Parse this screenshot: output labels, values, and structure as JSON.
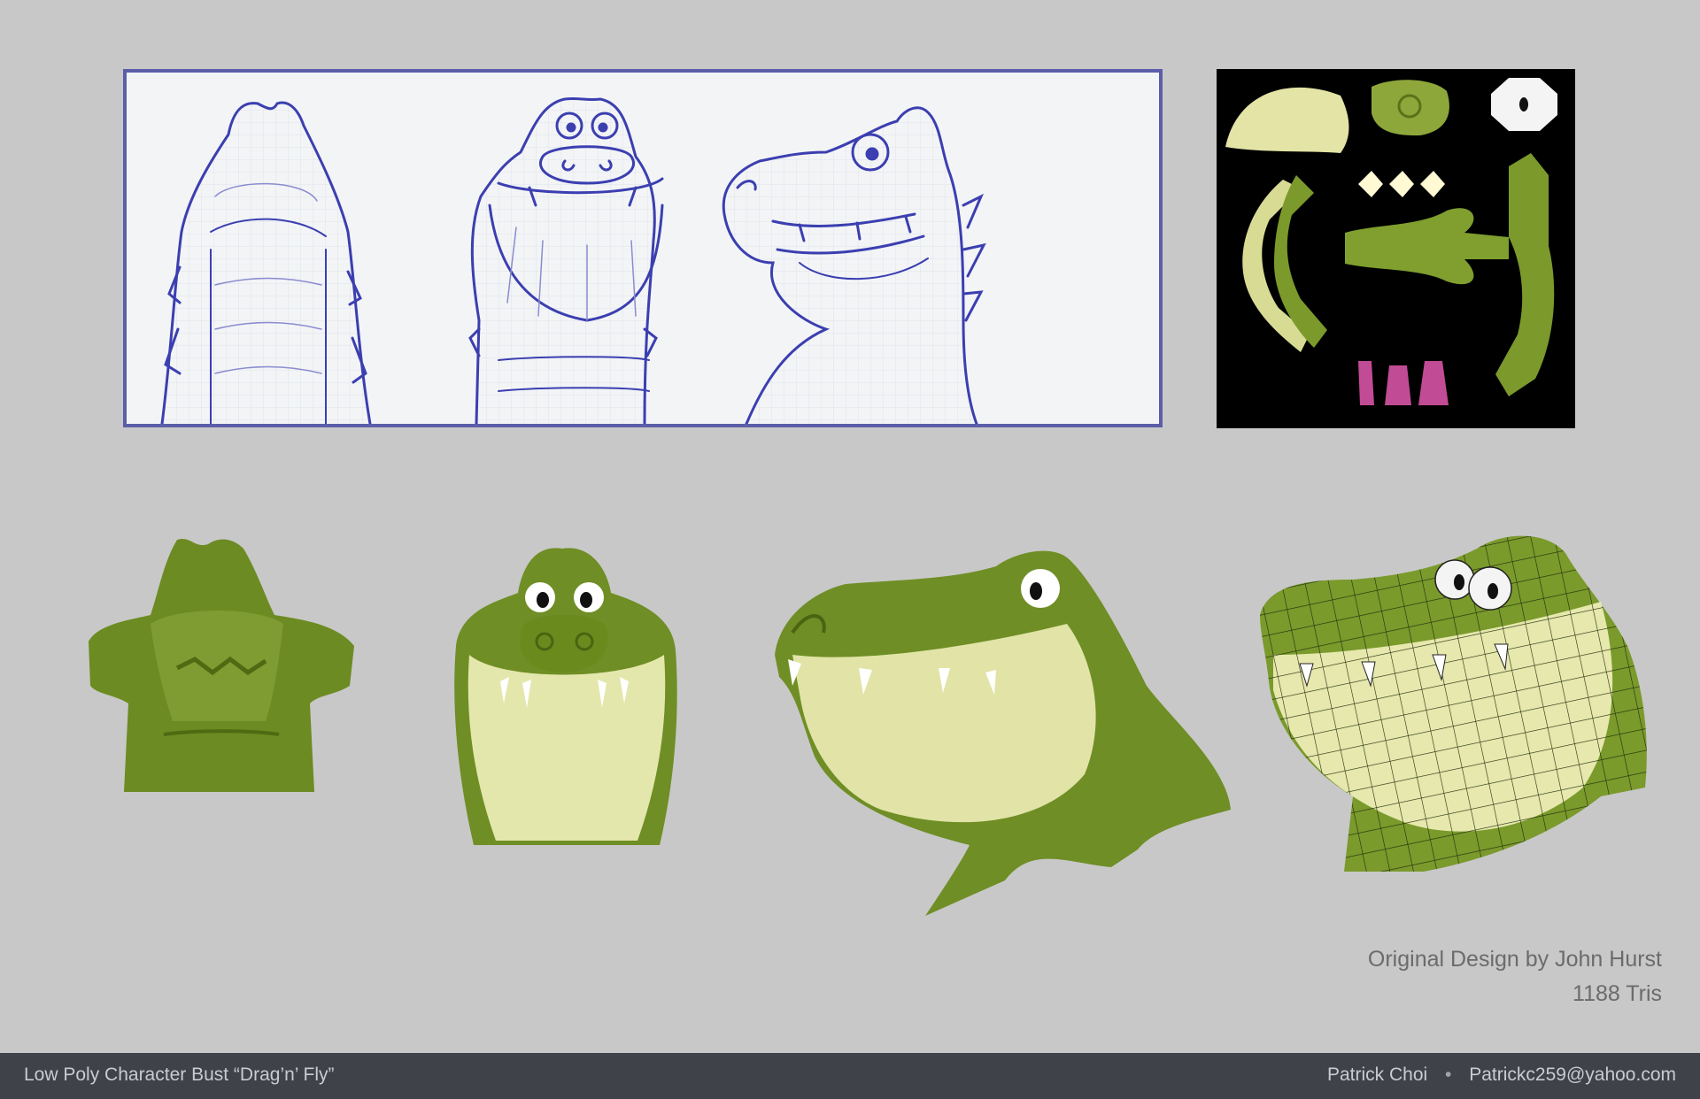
{
  "credits": {
    "design": "Original Design by John Hurst",
    "tris": "1188 Tris"
  },
  "footer": {
    "title": "Low Poly Character Bust  “Drag’n’ Fly”",
    "author": "Patrick Choi",
    "separator": "•",
    "email": "Patrickc259@yahoo.com"
  },
  "colors": {
    "background": "#c8c8c8",
    "sketch_line": "#3b3fb0",
    "sketch_border": "#5b5ea8",
    "skin_green": "#6b8a1f",
    "belly_yellow": "#e8eab0",
    "footer_bg": "#3f4249"
  }
}
